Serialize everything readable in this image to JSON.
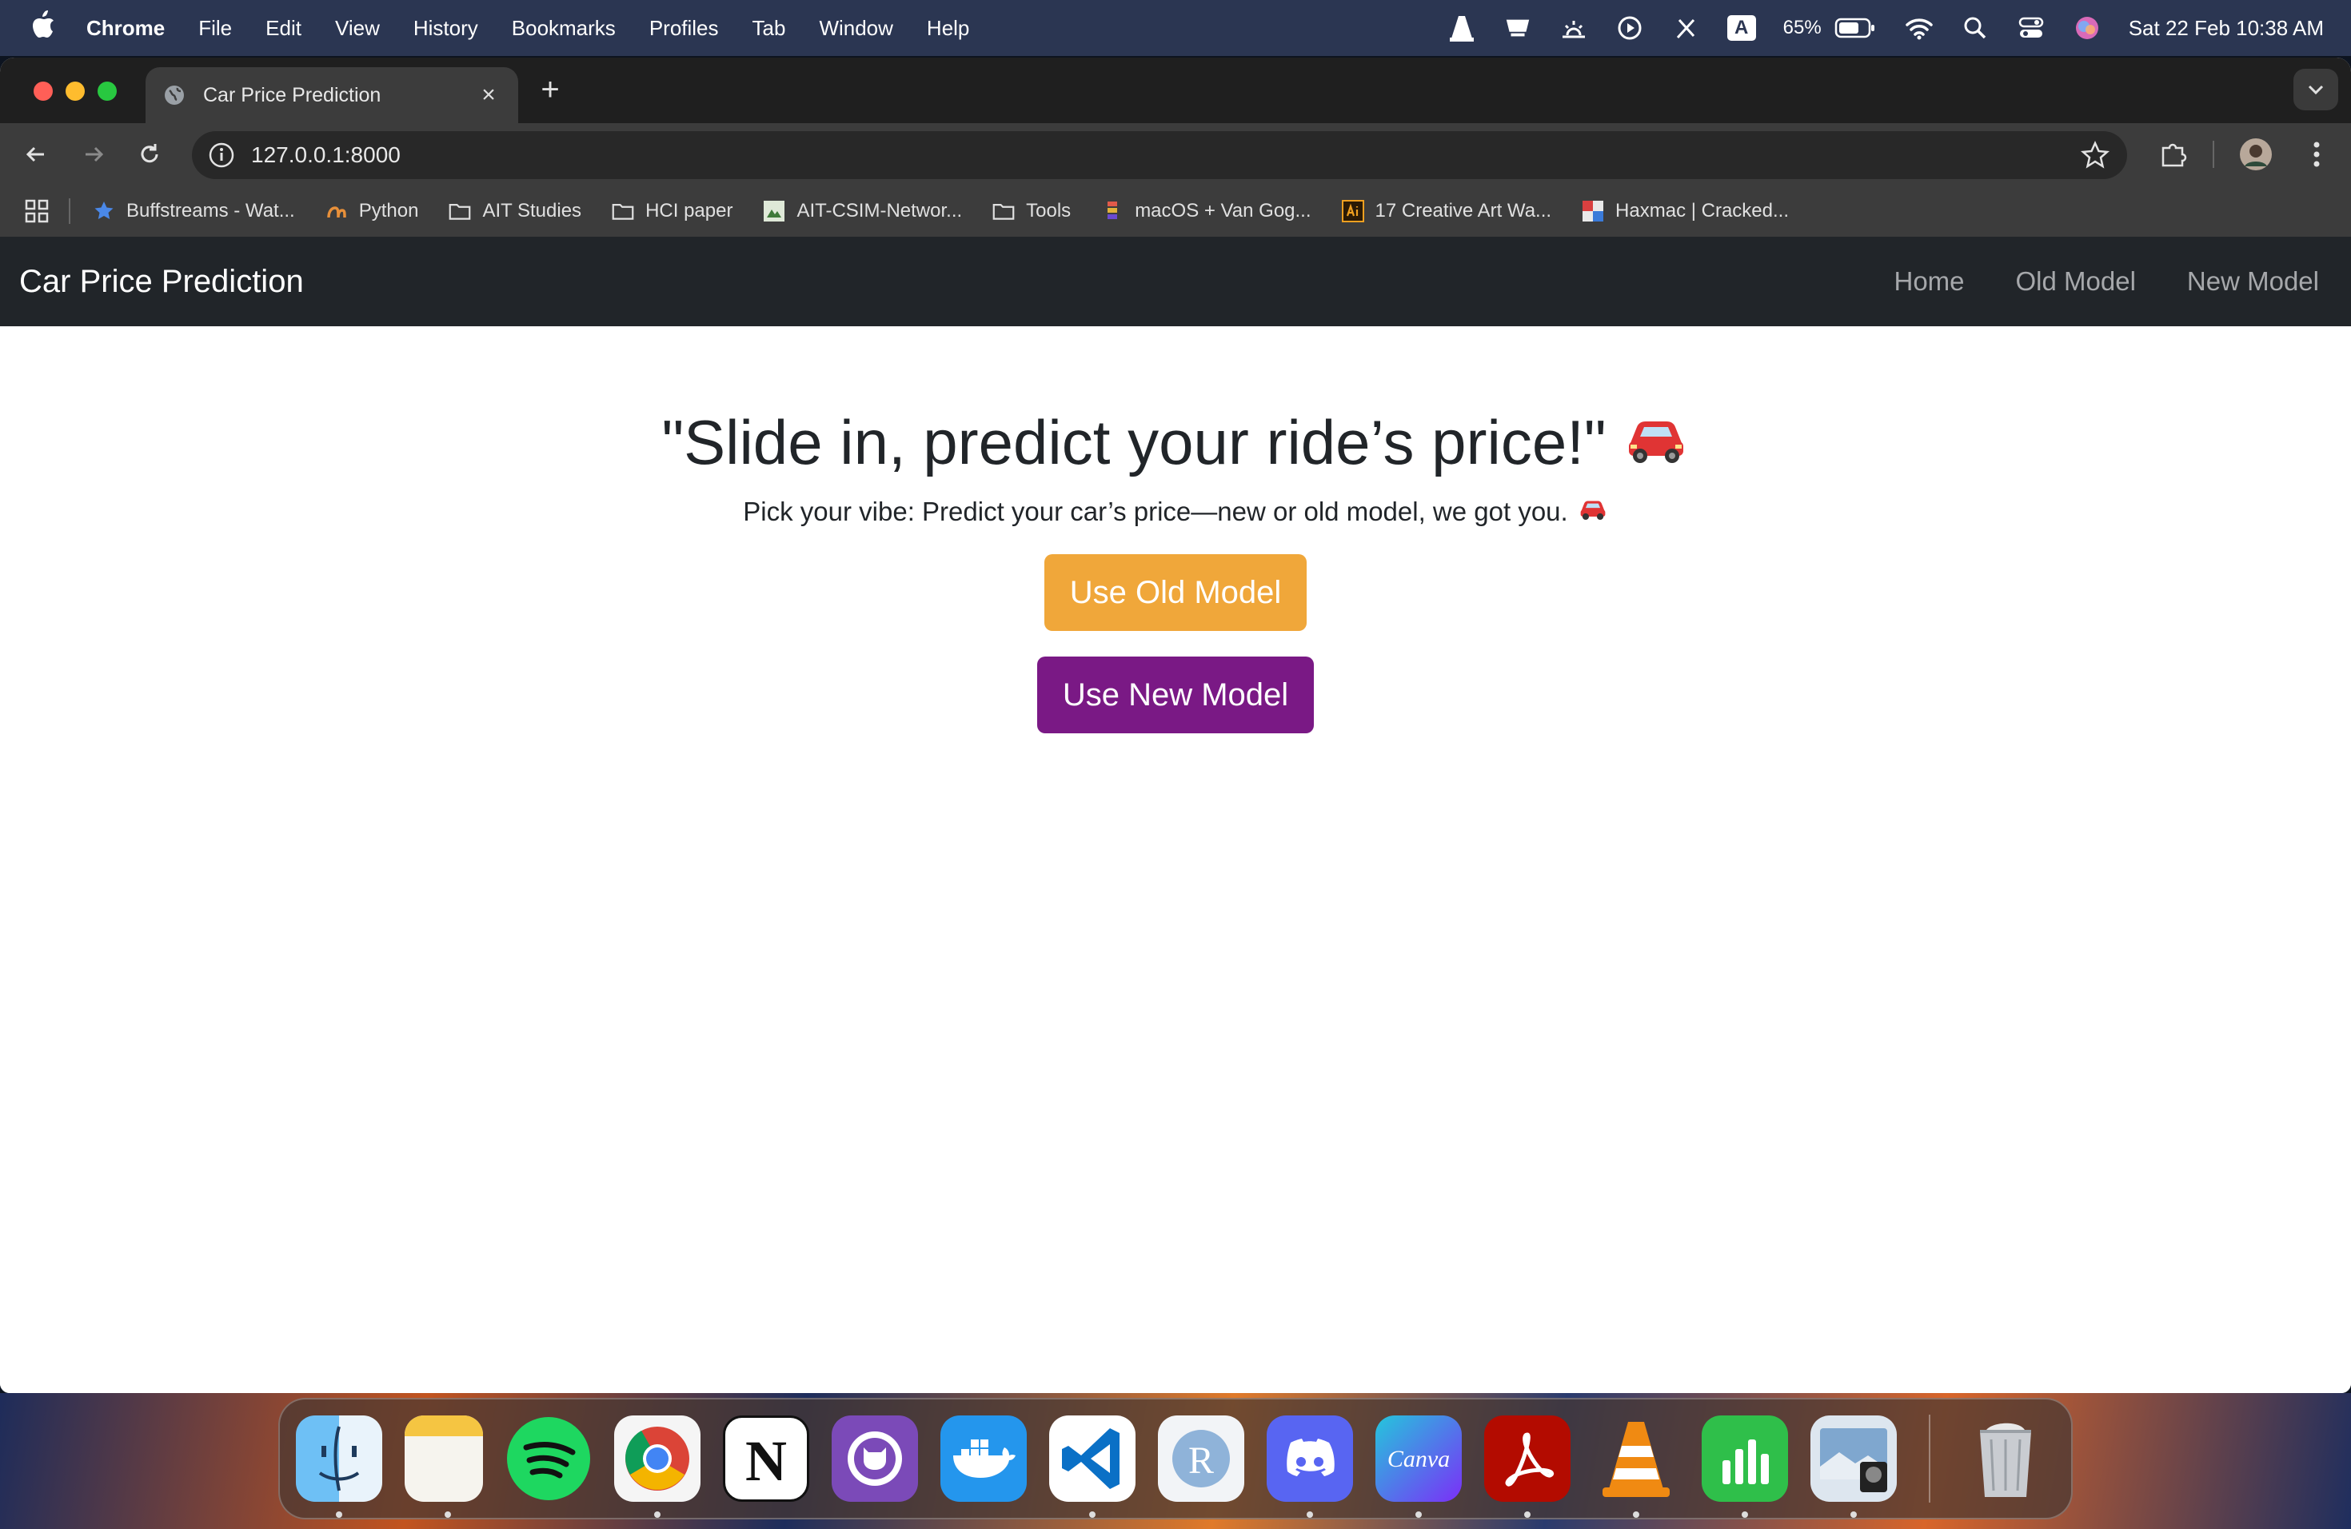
{
  "menubar": {
    "app": "Chrome",
    "items": [
      "File",
      "Edit",
      "View",
      "History",
      "Bookmarks",
      "Profiles",
      "Tab",
      "Window",
      "Help"
    ],
    "battery": "65%",
    "clock": "Sat 22 Feb  10:38 AM",
    "input_source": "A"
  },
  "browser": {
    "tab_title": "Car Price Prediction",
    "tab_close": "×",
    "new_tab": "+",
    "url": "127.0.0.1:8000",
    "bookmarks": [
      {
        "label": "Buffstreams - Wat...",
        "icon": "star-icon"
      },
      {
        "label": "Python",
        "icon": "python-icon"
      },
      {
        "label": "AIT Studies",
        "icon": "folder-icon"
      },
      {
        "label": "HCI paper",
        "icon": "folder-icon"
      },
      {
        "label": "AIT-CSIM-Networ...",
        "icon": "site-icon"
      },
      {
        "label": "Tools",
        "icon": "folder-icon"
      },
      {
        "label": "macOS + Van Gog...",
        "icon": "site-icon"
      },
      {
        "label": "17 Creative Art Wa...",
        "icon": "ai-icon"
      },
      {
        "label": "Haxmac | Cracked...",
        "icon": "site-icon"
      }
    ]
  },
  "page": {
    "navbar": {
      "brand": "Car Price Prediction",
      "links": [
        "Home",
        "Old Model",
        "New Model"
      ]
    },
    "hero": {
      "title": "\"Slide in, predict your ride’s price!\"",
      "title_emoji": "🚗",
      "subtitle": "Pick your vibe: Predict your car’s price—new or old model, we got you.",
      "subtitle_emoji": "🚗",
      "old_button": "Use Old Model",
      "new_button": "Use New Model"
    },
    "colors": {
      "navbar": "#212529",
      "old_button": "#f0a73a",
      "new_button": "#7a1985"
    }
  },
  "dock": {
    "apps": [
      "finder-icon",
      "notes-icon",
      "spotify-icon",
      "chrome-icon",
      "notion-icon",
      "github-desktop-icon",
      "docker-icon",
      "vscode-icon",
      "r-icon",
      "discord-icon",
      "canva-icon",
      "acrobat-icon",
      "vlc-icon",
      "numbers-icon",
      "preview-icon"
    ],
    "trash": "trash-icon"
  }
}
